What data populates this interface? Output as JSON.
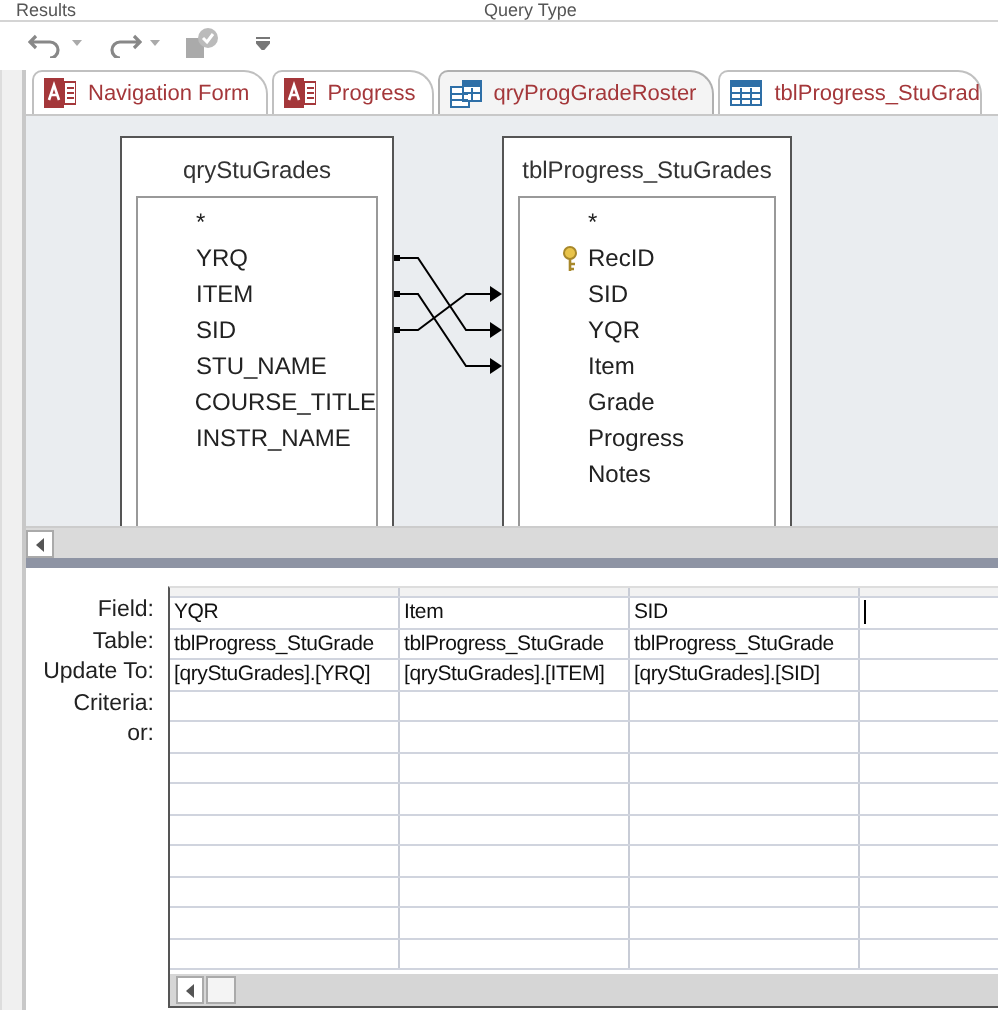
{
  "ribbon_groups": [
    "Results",
    "Query Type"
  ],
  "tabs": [
    {
      "label": "Navigation Form",
      "kind": "form",
      "selected": false
    },
    {
      "label": "Progress",
      "kind": "form",
      "selected": false
    },
    {
      "label": "qryProgGradeRoster",
      "kind": "query",
      "selected": true
    },
    {
      "label": "tblProgress_StuGrad",
      "kind": "table",
      "selected": false
    }
  ],
  "field_lists": [
    {
      "title": "qryStuGrades",
      "fields": [
        {
          "name": "*",
          "primary_key": false
        },
        {
          "name": "YRQ",
          "primary_key": false
        },
        {
          "name": "ITEM",
          "primary_key": false
        },
        {
          "name": "SID",
          "primary_key": false
        },
        {
          "name": "STU_NAME",
          "primary_key": false
        },
        {
          "name": "COURSE_TITLE",
          "primary_key": false
        },
        {
          "name": "INSTR_NAME",
          "primary_key": false
        }
      ]
    },
    {
      "title": "tblProgress_StuGrades",
      "fields": [
        {
          "name": "*",
          "primary_key": false
        },
        {
          "name": "RecID",
          "primary_key": true
        },
        {
          "name": "SID",
          "primary_key": false
        },
        {
          "name": "YQR",
          "primary_key": false
        },
        {
          "name": "Item",
          "primary_key": false
        },
        {
          "name": "Grade",
          "primary_key": false
        },
        {
          "name": "Progress",
          "primary_key": false
        },
        {
          "name": "Notes",
          "primary_key": false
        }
      ]
    }
  ],
  "grid": {
    "rows": [
      {
        "label": "Field:",
        "cells": [
          "YQR",
          "Item",
          "SID"
        ]
      },
      {
        "label": "Table:",
        "cells": [
          "tblProgress_StuGrade",
          "tblProgress_StuGrade",
          "tblProgress_StuGrade"
        ]
      },
      {
        "label": "Update To:",
        "cells": [
          "[qryStuGrades].[YRQ]",
          "[qryStuGrades].[ITEM]",
          "[qryStuGrades].[SID]"
        ]
      },
      {
        "label": "Criteria:",
        "cells": []
      },
      {
        "label": "or:",
        "cells": []
      }
    ]
  }
}
